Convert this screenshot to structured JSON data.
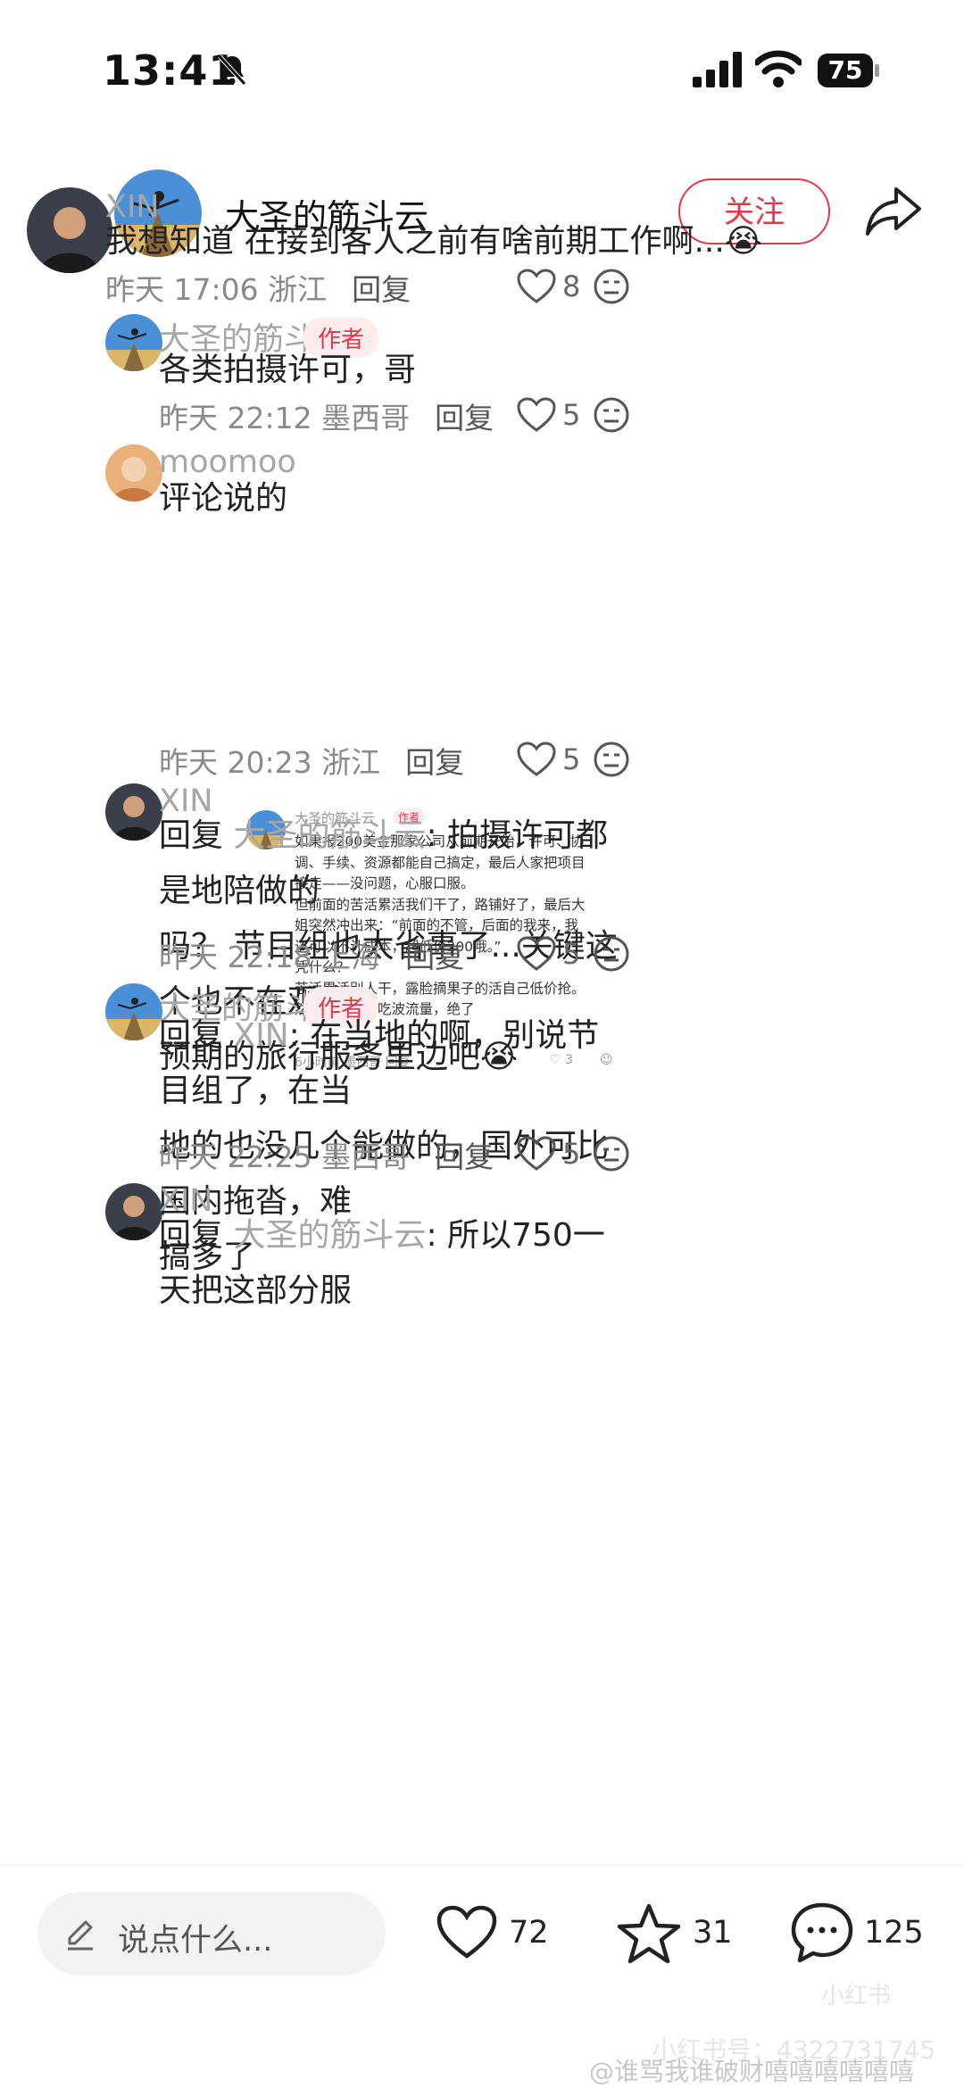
{
  "status_bar": {
    "time": "13:41",
    "battery": "75"
  },
  "header": {
    "title": "大圣的筋斗云",
    "follow_label": "关注"
  },
  "comments": [
    {
      "user": "XIN",
      "text": "我想知道 在接到客人之前有啥前期工作啊...😭",
      "time": "昨天 17:06",
      "location": "浙江",
      "reply_label": "回复",
      "likes": "8"
    },
    {
      "user": "大圣的筋斗云",
      "badge": "作者",
      "text": "各类拍摄许可，哥",
      "time": "昨天 22:12",
      "location": "墨西哥",
      "reply_label": "回复",
      "likes": "5"
    },
    {
      "user": "moomoo",
      "text": "评论说的",
      "time": "昨天 20:23",
      "location": "浙江",
      "reply_label": "回复",
      "likes": "5",
      "embed": {
        "user": "大圣的筋斗云",
        "badge": "作者",
        "lines": [
          "如果报200美金那家公司从前期开始，许可、协",
          "调、手续、资源都能自己搞定，最后人家把项目",
          "接走——没问题，心服口服。",
          "但前面的苦活累活我们干了，路铺好了，最后大",
          "姐突然冲出来：“前面的不管，后面的我来，我",
          "还可以不计成本，超低价200哦。”",
          "凭什么？",
          "苦活累活别人干，露脸摘果子的活自己低价抢。",
          "然后还美滋滋吃波流量，绝了"
        ],
        "meta": "6小时前 墨西哥  回复",
        "likes": "3"
      }
    },
    {
      "user": "XIN",
      "reply_prefix": "回复 ",
      "mention": "大圣的筋斗云",
      "reply_sep": ": ",
      "text_lines": [
        "拍摄许可都是地陪做的",
        "吗？ 节目组也太省事了...关键这个也不在观众",
        "预期的旅行服务里边吧😭"
      ],
      "time": "昨天 22:18",
      "location": "上海",
      "reply_label": "回复",
      "likes": "5"
    },
    {
      "user": "大圣的筋斗云",
      "badge": "作者",
      "reply_prefix": "回复 ",
      "mention": "XIN",
      "reply_sep": ": ",
      "text_lines": [
        "在当地的啊，别说节目组了，在当",
        "地的也没几个能做的，国外可比国内拖沓，难",
        "搞多了"
      ],
      "time": "昨天 22:25",
      "location": "墨西哥",
      "reply_label": "回复",
      "likes": "5"
    },
    {
      "user": "XIN",
      "reply_prefix": "回复 ",
      "mention": "大圣的筋斗云",
      "reply_sep": ": ",
      "text_lines": [
        "所以750一天把这部分服"
      ]
    }
  ],
  "bottom_bar": {
    "placeholder": "说点什么...",
    "likes": "72",
    "stars": "31",
    "comments": "125"
  },
  "watermark": {
    "line1": "小红书",
    "line2": "小红书号：4322731745",
    "line3": "@谁骂我谁破财嘻嘻嘻嘻嘻嘻"
  }
}
